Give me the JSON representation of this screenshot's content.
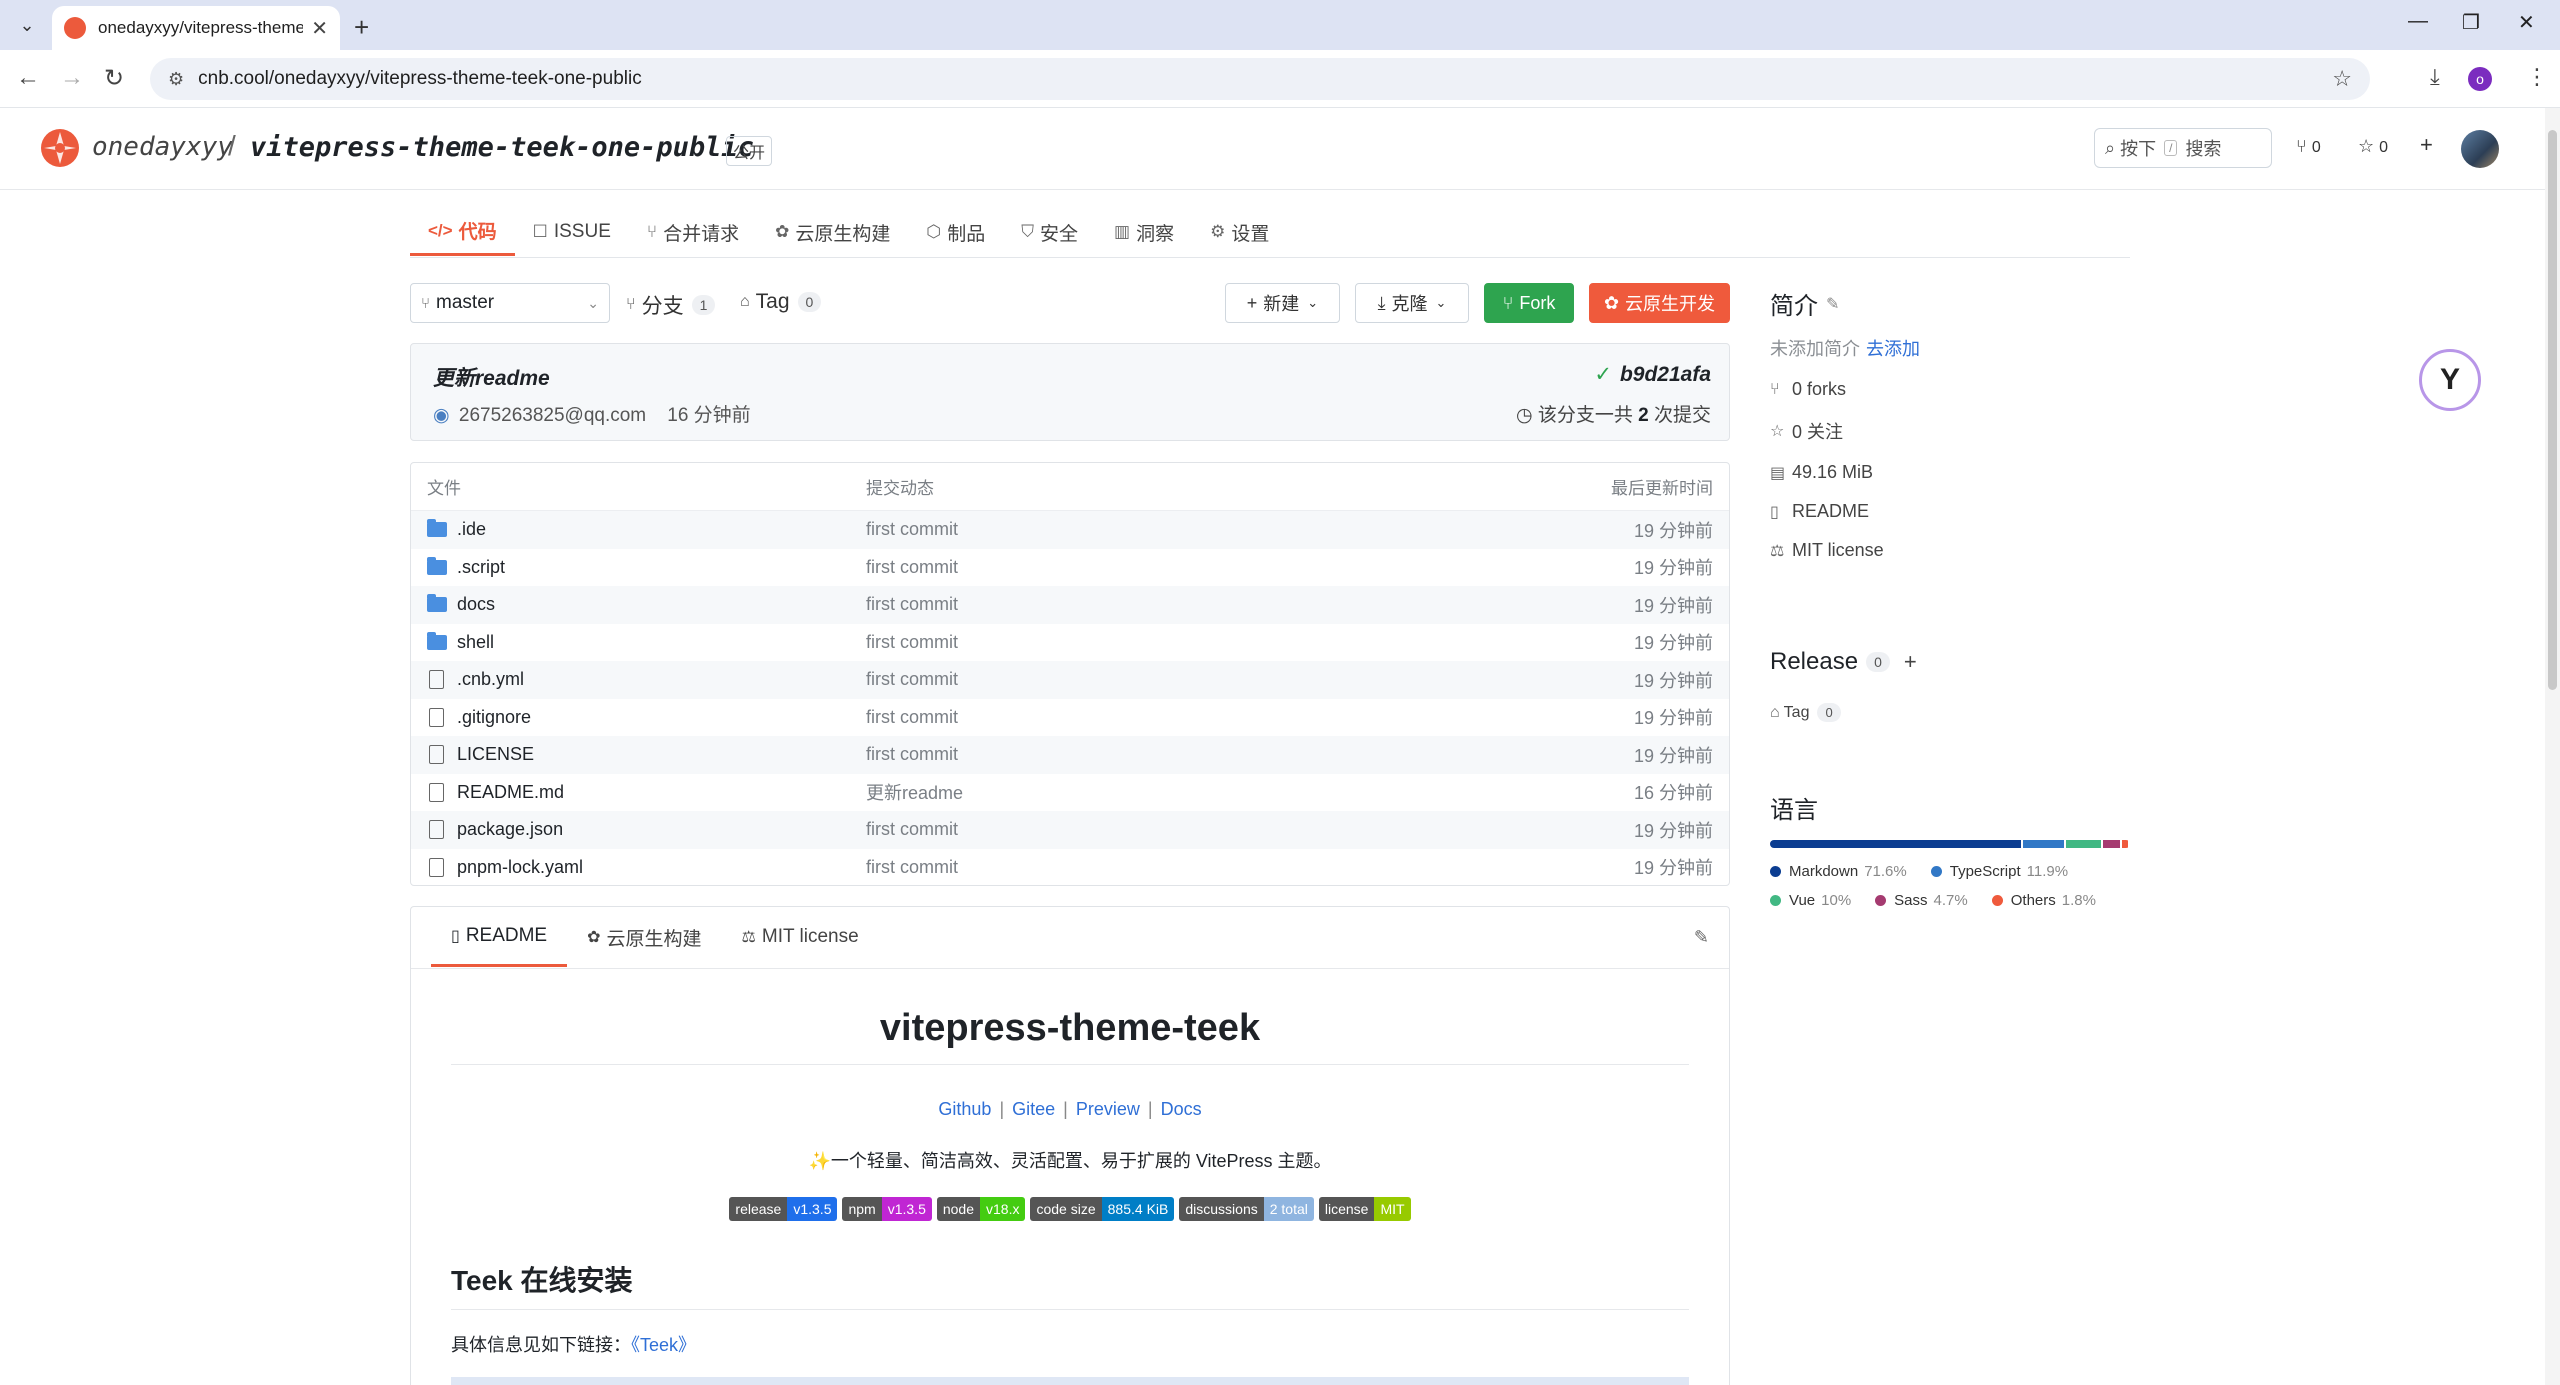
{
  "browser": {
    "tab_title": "onedayxyy/vitepress-theme-teek-one-public",
    "url": "cnb.cool/onedayxyy/vitepress-theme-teek-one-public",
    "profile_initial": "o"
  },
  "header": {
    "owner": "onedayxyy",
    "separator": "/",
    "repo": "vitepress-theme-teek-one-public",
    "visibility": "公开",
    "search_prefix": "按下",
    "search_key": "/",
    "search_label": "搜索",
    "fork_count": "0",
    "star_count": "0"
  },
  "tabs": [
    {
      "label": "代码",
      "icon": "code-icon"
    },
    {
      "label": "ISSUE",
      "icon": "issue-icon"
    },
    {
      "label": "合并请求",
      "icon": "merge-request-icon"
    },
    {
      "label": "云原生构建",
      "icon": "build-icon"
    },
    {
      "label": "制品",
      "icon": "package-icon"
    },
    {
      "label": "安全",
      "icon": "shield-icon"
    },
    {
      "label": "洞察",
      "icon": "insight-icon"
    },
    {
      "label": "设置",
      "icon": "gear-icon"
    }
  ],
  "branch": {
    "name": "master",
    "branches_label": "分支",
    "branches_count": "1",
    "tags_label": "Tag",
    "tags_count": "0",
    "new_label": "新建",
    "clone_label": "克隆",
    "fork_label": "Fork",
    "dev_label": "云原生开发"
  },
  "commit": {
    "message": "更新readme",
    "hash": "b9d21afa",
    "author": "2675263825@qq.com",
    "time": "16 分钟前",
    "total_prefix": "该分支一共",
    "total_count": "2",
    "total_suffix": "次提交"
  },
  "file_table": {
    "headers": [
      "文件",
      "提交动态",
      "最后更新时间"
    ],
    "rows": [
      {
        "name": ".ide",
        "type": "folder",
        "message": "first commit",
        "time": "19 分钟前"
      },
      {
        "name": ".script",
        "type": "folder",
        "message": "first commit",
        "time": "19 分钟前"
      },
      {
        "name": "docs",
        "type": "folder",
        "message": "first commit",
        "time": "19 分钟前"
      },
      {
        "name": "shell",
        "type": "folder",
        "message": "first commit",
        "time": "19 分钟前"
      },
      {
        "name": ".cnb.yml",
        "type": "file",
        "message": "first commit",
        "time": "19 分钟前"
      },
      {
        "name": ".gitignore",
        "type": "file",
        "message": "first commit",
        "time": "19 分钟前"
      },
      {
        "name": "LICENSE",
        "type": "file",
        "message": "first commit",
        "time": "19 分钟前"
      },
      {
        "name": "README.md",
        "type": "file",
        "message": "更新readme",
        "time": "16 分钟前"
      },
      {
        "name": "package.json",
        "type": "file",
        "message": "first commit",
        "time": "19 分钟前"
      },
      {
        "name": "pnpm-lock.yaml",
        "type": "file",
        "message": "first commit",
        "time": "19 分钟前"
      }
    ]
  },
  "readme": {
    "tabs": [
      "README",
      "云原生构建",
      "MIT license"
    ],
    "title": "vitepress-theme-teek",
    "links": [
      "Github",
      "Gitee",
      "Preview",
      "Docs"
    ],
    "description": "一个轻量、简洁高效、灵活配置、易于扩展的 VitePress 主题。",
    "badges": [
      {
        "left": "release",
        "right": "v1.3.5",
        "color": "#1f6feb"
      },
      {
        "left": "npm",
        "right": "v1.3.5",
        "color": "#c026d3"
      },
      {
        "left": "node",
        "right": "v18.x",
        "color": "#4c1"
      },
      {
        "left": "code size",
        "right": "885.4 KiB",
        "color": "#007ec6"
      },
      {
        "left": "discussions",
        "right": "2 total",
        "color": "#8fb5e0"
      },
      {
        "left": "license",
        "right": "MIT",
        "color": "#97ca00"
      }
    ],
    "section_title": "Teek 在线安装",
    "section_text": "具体信息见如下链接：",
    "section_link": "《Teek》"
  },
  "sidebar": {
    "intro_title": "简介",
    "intro_empty": "未添加简介",
    "intro_add": "去添加",
    "stats": [
      {
        "icon": "fork-icon",
        "label": "0 forks"
      },
      {
        "icon": "star-icon",
        "label": "0 关注"
      },
      {
        "icon": "database-icon",
        "label": "49.16 MiB"
      },
      {
        "icon": "book-icon",
        "label": "README"
      },
      {
        "icon": "scale-icon",
        "label": "MIT license"
      }
    ],
    "release_title": "Release",
    "release_count": "0",
    "tag_label": "Tag",
    "tag_count": "0",
    "lang_title": "语言",
    "languages": [
      {
        "name": "Markdown",
        "percent": "71.6%",
        "value": 71.6,
        "color": "#0b3d91"
      },
      {
        "name": "TypeScript",
        "percent": "11.9%",
        "value": 11.9,
        "color": "#3178c6"
      },
      {
        "name": "Vue",
        "percent": "10%",
        "value": 10,
        "color": "#41b883"
      },
      {
        "name": "Sass",
        "percent": "4.7%",
        "value": 4.7,
        "color": "#a53b70"
      },
      {
        "name": "Others",
        "percent": "1.8%",
        "value": 1.8,
        "color": "#ef5a3c"
      }
    ]
  }
}
